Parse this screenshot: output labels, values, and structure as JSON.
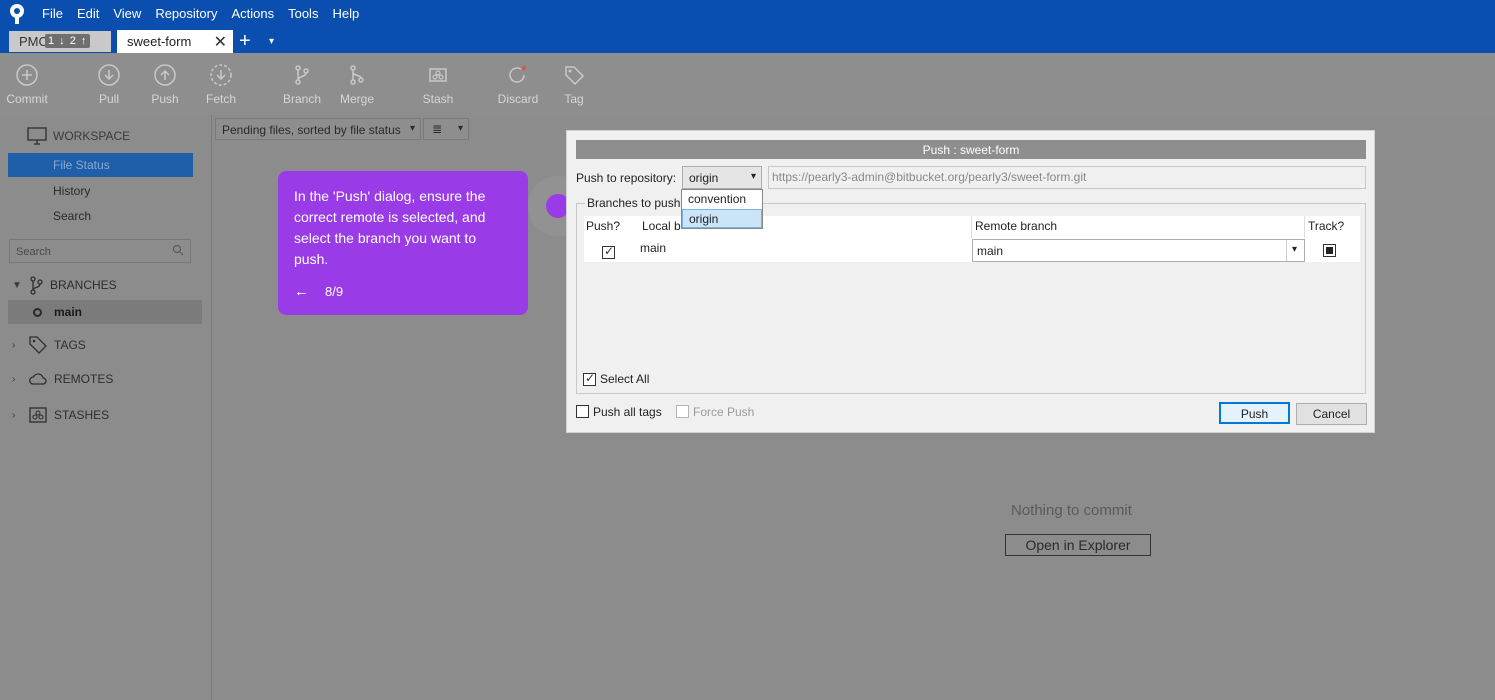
{
  "menu": [
    "File",
    "Edit",
    "View",
    "Repository",
    "Actions",
    "Tools",
    "Help"
  ],
  "tabs": {
    "pmc_label": "PMC",
    "pmc_badge": "1 ↓ 2 ↑",
    "active_label": "sweet-form",
    "close_glyph": "✕",
    "plus_glyph": "+",
    "caret_glyph": "▾"
  },
  "toolbar": {
    "commit": "Commit",
    "pull": "Pull",
    "push": "Push",
    "fetch": "Fetch",
    "branch": "Branch",
    "merge": "Merge",
    "stash": "Stash",
    "discard": "Discard",
    "tag": "Tag"
  },
  "sidebar": {
    "workspace": "WORKSPACE",
    "file_status": "File Status",
    "history": "History",
    "search": "Search",
    "search_placeholder": "Search",
    "branches": "BRANCHES",
    "main_branch": "main",
    "tags": "TAGS",
    "remotes": "REMOTES",
    "stashes": "STASHES"
  },
  "main": {
    "pending_filter": "Pending files, sorted by file status",
    "view_glyph": "≣",
    "nothing": "Nothing to commit",
    "open_explorer": "Open in Explorer"
  },
  "tooltip": {
    "text": "In the 'Push' dialog, ensure the correct remote is selected, and select the branch you want to push.",
    "arrow": "←",
    "step": "8/9"
  },
  "dialog": {
    "title": "Push : sweet-form",
    "push_to_label": "Push to repository:",
    "selected_remote": "origin",
    "remote_url": "https://pearly3-admin@bitbucket.org/pearly3/sweet-form.git",
    "remote_options": [
      "convention",
      "origin"
    ],
    "branches_label": "Branches to push",
    "col_push": "Push?",
    "col_local": "Local b",
    "col_remote": "Remote branch",
    "col_track": "Track?",
    "row_local": "main",
    "row_remote": "main",
    "select_all": "Select All",
    "push_all_tags": "Push all tags",
    "force_push": "Force Push",
    "push_button": "Push",
    "cancel_button": "Cancel"
  },
  "colors": {
    "titlebar": "#0a4fb0",
    "tooltip": "#9a3be8",
    "selection": "#1f5ea8"
  }
}
